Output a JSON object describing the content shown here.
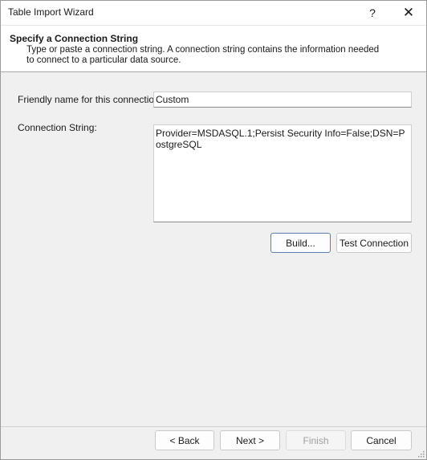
{
  "window": {
    "title": "Table Import Wizard",
    "help_glyph": "?",
    "close_glyph": "✕"
  },
  "header": {
    "title": "Specify a Connection String",
    "description": "Type or paste a connection string. A connection string contains the information needed to connect to a particular data source."
  },
  "form": {
    "friendly_name_label": "Friendly name for this connection:",
    "friendly_name_value": "Custom",
    "connection_string_label": "Connection String:",
    "connection_string_value": "Provider=MSDASQL.1;Persist Security Info=False;DSN=PostgreSQL"
  },
  "buttons": {
    "build": "Build...",
    "test_connection": "Test Connection",
    "back": "< Back",
    "next": "Next >",
    "finish": "Finish",
    "cancel": "Cancel"
  }
}
